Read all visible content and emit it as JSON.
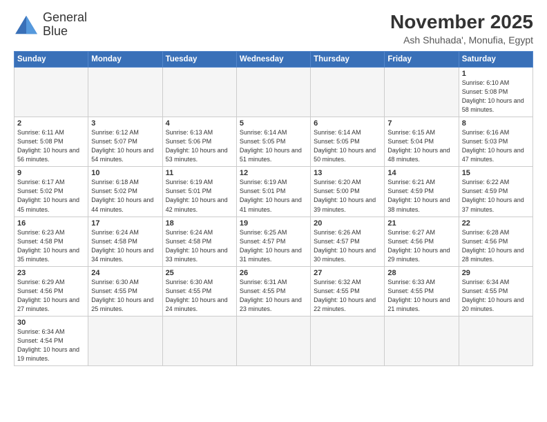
{
  "logo": {
    "line1": "General",
    "line2": "Blue"
  },
  "header": {
    "month_year": "November 2025",
    "location": "Ash Shuhada', Monufia, Egypt"
  },
  "weekdays": [
    "Sunday",
    "Monday",
    "Tuesday",
    "Wednesday",
    "Thursday",
    "Friday",
    "Saturday"
  ],
  "weeks": [
    [
      {
        "day": "",
        "info": ""
      },
      {
        "day": "",
        "info": ""
      },
      {
        "day": "",
        "info": ""
      },
      {
        "day": "",
        "info": ""
      },
      {
        "day": "",
        "info": ""
      },
      {
        "day": "",
        "info": ""
      },
      {
        "day": "1",
        "info": "Sunrise: 6:10 AM\nSunset: 5:08 PM\nDaylight: 10 hours\nand 58 minutes."
      }
    ],
    [
      {
        "day": "2",
        "info": "Sunrise: 6:11 AM\nSunset: 5:08 PM\nDaylight: 10 hours\nand 56 minutes."
      },
      {
        "day": "3",
        "info": "Sunrise: 6:12 AM\nSunset: 5:07 PM\nDaylight: 10 hours\nand 54 minutes."
      },
      {
        "day": "4",
        "info": "Sunrise: 6:13 AM\nSunset: 5:06 PM\nDaylight: 10 hours\nand 53 minutes."
      },
      {
        "day": "5",
        "info": "Sunrise: 6:14 AM\nSunset: 5:05 PM\nDaylight: 10 hours\nand 51 minutes."
      },
      {
        "day": "6",
        "info": "Sunrise: 6:14 AM\nSunset: 5:05 PM\nDaylight: 10 hours\nand 50 minutes."
      },
      {
        "day": "7",
        "info": "Sunrise: 6:15 AM\nSunset: 5:04 PM\nDaylight: 10 hours\nand 48 minutes."
      },
      {
        "day": "8",
        "info": "Sunrise: 6:16 AM\nSunset: 5:03 PM\nDaylight: 10 hours\nand 47 minutes."
      }
    ],
    [
      {
        "day": "9",
        "info": "Sunrise: 6:17 AM\nSunset: 5:02 PM\nDaylight: 10 hours\nand 45 minutes."
      },
      {
        "day": "10",
        "info": "Sunrise: 6:18 AM\nSunset: 5:02 PM\nDaylight: 10 hours\nand 44 minutes."
      },
      {
        "day": "11",
        "info": "Sunrise: 6:19 AM\nSunset: 5:01 PM\nDaylight: 10 hours\nand 42 minutes."
      },
      {
        "day": "12",
        "info": "Sunrise: 6:19 AM\nSunset: 5:01 PM\nDaylight: 10 hours\nand 41 minutes."
      },
      {
        "day": "13",
        "info": "Sunrise: 6:20 AM\nSunset: 5:00 PM\nDaylight: 10 hours\nand 39 minutes."
      },
      {
        "day": "14",
        "info": "Sunrise: 6:21 AM\nSunset: 4:59 PM\nDaylight: 10 hours\nand 38 minutes."
      },
      {
        "day": "15",
        "info": "Sunrise: 6:22 AM\nSunset: 4:59 PM\nDaylight: 10 hours\nand 37 minutes."
      }
    ],
    [
      {
        "day": "16",
        "info": "Sunrise: 6:23 AM\nSunset: 4:58 PM\nDaylight: 10 hours\nand 35 minutes."
      },
      {
        "day": "17",
        "info": "Sunrise: 6:24 AM\nSunset: 4:58 PM\nDaylight: 10 hours\nand 34 minutes."
      },
      {
        "day": "18",
        "info": "Sunrise: 6:24 AM\nSunset: 4:58 PM\nDaylight: 10 hours\nand 33 minutes."
      },
      {
        "day": "19",
        "info": "Sunrise: 6:25 AM\nSunset: 4:57 PM\nDaylight: 10 hours\nand 31 minutes."
      },
      {
        "day": "20",
        "info": "Sunrise: 6:26 AM\nSunset: 4:57 PM\nDaylight: 10 hours\nand 30 minutes."
      },
      {
        "day": "21",
        "info": "Sunrise: 6:27 AM\nSunset: 4:56 PM\nDaylight: 10 hours\nand 29 minutes."
      },
      {
        "day": "22",
        "info": "Sunrise: 6:28 AM\nSunset: 4:56 PM\nDaylight: 10 hours\nand 28 minutes."
      }
    ],
    [
      {
        "day": "23",
        "info": "Sunrise: 6:29 AM\nSunset: 4:56 PM\nDaylight: 10 hours\nand 27 minutes."
      },
      {
        "day": "24",
        "info": "Sunrise: 6:30 AM\nSunset: 4:55 PM\nDaylight: 10 hours\nand 25 minutes."
      },
      {
        "day": "25",
        "info": "Sunrise: 6:30 AM\nSunset: 4:55 PM\nDaylight: 10 hours\nand 24 minutes."
      },
      {
        "day": "26",
        "info": "Sunrise: 6:31 AM\nSunset: 4:55 PM\nDaylight: 10 hours\nand 23 minutes."
      },
      {
        "day": "27",
        "info": "Sunrise: 6:32 AM\nSunset: 4:55 PM\nDaylight: 10 hours\nand 22 minutes."
      },
      {
        "day": "28",
        "info": "Sunrise: 6:33 AM\nSunset: 4:55 PM\nDaylight: 10 hours\nand 21 minutes."
      },
      {
        "day": "29",
        "info": "Sunrise: 6:34 AM\nSunset: 4:55 PM\nDaylight: 10 hours\nand 20 minutes."
      }
    ],
    [
      {
        "day": "30",
        "info": "Sunrise: 6:34 AM\nSunset: 4:54 PM\nDaylight: 10 hours\nand 19 minutes."
      },
      {
        "day": "",
        "info": ""
      },
      {
        "day": "",
        "info": ""
      },
      {
        "day": "",
        "info": ""
      },
      {
        "day": "",
        "info": ""
      },
      {
        "day": "",
        "info": ""
      },
      {
        "day": "",
        "info": ""
      }
    ]
  ]
}
